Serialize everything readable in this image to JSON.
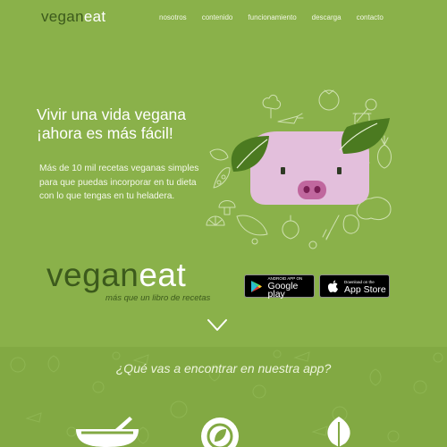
{
  "nav": {
    "logo_a": "vegan",
    "logo_b": "eat",
    "items": [
      "nosotros",
      "contenido",
      "funcionamiento",
      "descarga",
      "contacto"
    ]
  },
  "hero": {
    "title_line1": "Vivir una vida vegana",
    "title_line2": "¡ahora es más fácil!",
    "text": "Más de 10 mil recetas veganas simples para que puedas incorporar en tu dieta con lo que tengas en tu heladera."
  },
  "brand": {
    "name_a": "vegan",
    "name_b": "eat",
    "tagline": "más que un libro de recetas"
  },
  "stores": {
    "google_small": "ANDROID APP ON",
    "google_big": "Google play",
    "apple_small": "Download on the",
    "apple_big": "App Store"
  },
  "section2": {
    "question": "¿Qué vas a encontrar en nuestra app?"
  },
  "colors": {
    "background": "#8ab14a",
    "dark_green": "#3c5a1c",
    "pig_pink": "#e3bfdc",
    "leaf_green": "#4b7a20"
  },
  "icons": [
    "chevron-down-icon",
    "google-play-icon",
    "apple-icon",
    "bowl-icon",
    "plate-icon",
    "leaf-icon",
    "pig-icon"
  ]
}
